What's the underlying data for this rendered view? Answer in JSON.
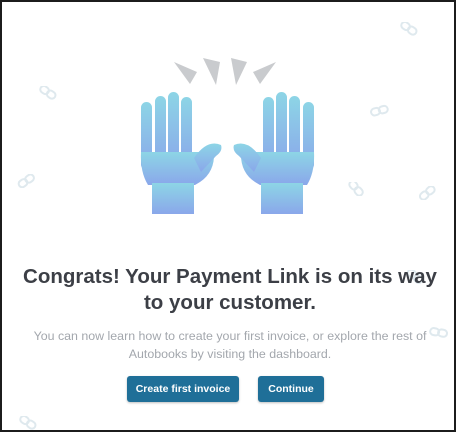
{
  "dialog": {
    "title": "Congrats! Your Payment Link is on its way to your customer.",
    "subtitle": "You can now learn how to create your first invoice, or explore the rest of Autobooks by visiting the dashboard.",
    "illustration_icon": "raised-hands-icon",
    "decoration_icon": "link-icon"
  },
  "actions": {
    "create_invoice_label": "Create first invoice",
    "continue_label": "Continue"
  },
  "colors": {
    "button_bg": "#1f6f98",
    "title_text": "#3c3f46",
    "subtitle_text": "#a3a7ad",
    "hand_top": "#8dd5e6",
    "hand_bottom": "#8aa7ea",
    "burst": "#c9cbce",
    "decoration": "#dfe9ee"
  }
}
